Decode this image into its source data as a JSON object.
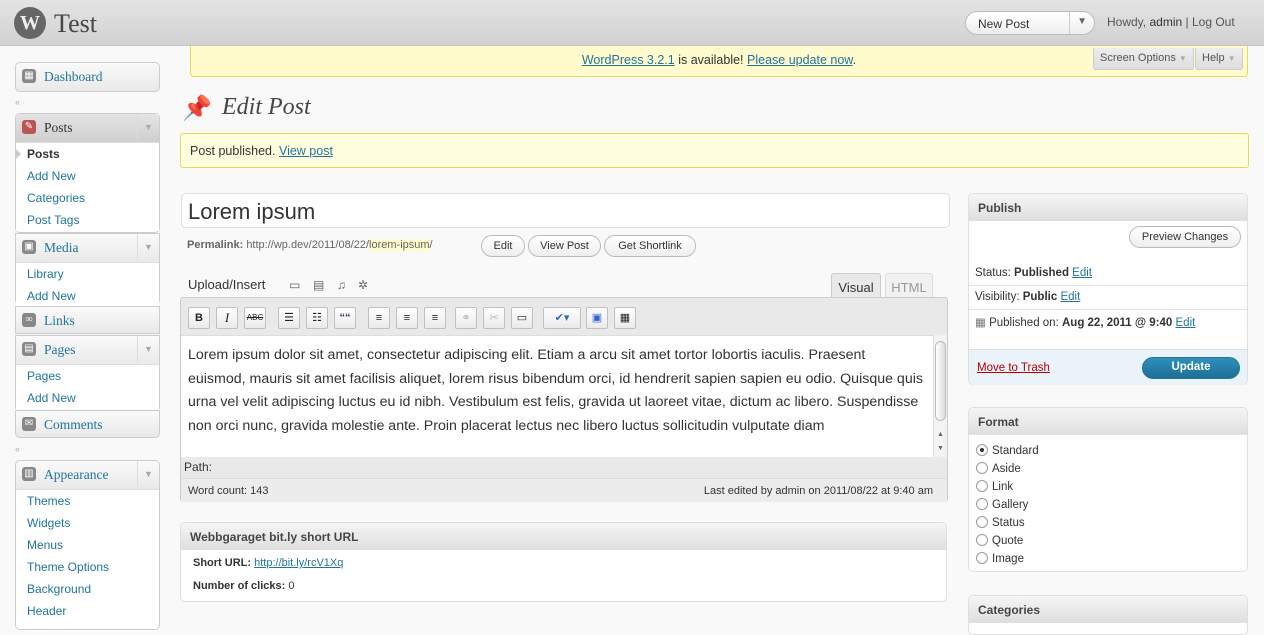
{
  "header": {
    "site_title": "Test",
    "new_post": "New Post",
    "howdy_prefix": "Howdy,",
    "user": "admin",
    "separator": "|",
    "logout": "Log Out"
  },
  "sidebar": {
    "dashboard": "Dashboard",
    "posts": {
      "label": "Posts",
      "items": [
        "Posts",
        "Add New",
        "Categories",
        "Post Tags"
      ]
    },
    "media": {
      "label": "Media",
      "items": [
        "Library",
        "Add New"
      ]
    },
    "links": "Links",
    "pages": {
      "label": "Pages",
      "items": [
        "Pages",
        "Add New"
      ]
    },
    "comments": "Comments",
    "appearance": {
      "label": "Appearance",
      "items": [
        "Themes",
        "Widgets",
        "Menus",
        "Theme Options",
        "Background",
        "Header"
      ]
    }
  },
  "update_notice": {
    "version_link": "WordPress 3.2.1",
    "text": " is available! ",
    "update_link": "Please update now",
    "end": "."
  },
  "screen_options": "Screen Options",
  "help": "Help",
  "page_title": "Edit Post",
  "message": {
    "text": "Post published. ",
    "link": "View post"
  },
  "post": {
    "title": "Lorem ipsum",
    "permalink_label": "Permalink:",
    "permalink_base": "http://wp.dev/2011/08/22/",
    "permalink_slug": "lorem-ipsum",
    "permalink_end": "/",
    "edit_button": "Edit",
    "view_button": "View Post",
    "shortlink_button": "Get Shortlink"
  },
  "editor": {
    "upload_label": "Upload/Insert",
    "tab_visual": "Visual",
    "tab_html": "HTML",
    "content": "Lorem ipsum dolor sit amet, consectetur adipiscing elit. Etiam a arcu sit amet tortor lobortis iaculis. Praesent euismod, mauris sit amet facilisis aliquet, lorem risus bibendum orci, id hendrerit sapien sapien eu odio. Quisque quis urna vel velit adipiscing luctus eu id nibh. Vestibulum est felis, gravida ut laoreet vitae, dictum ac libero. Suspendisse non orci nunc, gravida molestie ante. Proin placerat lectus nec libero luctus sollicitudin vulputate diam",
    "path_label": "Path:",
    "word_count": "Word count: 143",
    "last_edited": "Last edited by admin on 2011/08/22 at 9:40 am",
    "toolbar": {
      "bold": "B",
      "italic": "I",
      "strikethrough": "ABC",
      "blockquote": "““"
    }
  },
  "bitly": {
    "title": "Webbgaraget bit.ly short URL",
    "short_url_label": "Short URL:",
    "short_url": "http://bit.ly/rcV1Xq",
    "clicks_label": "Number of clicks:",
    "clicks": "0"
  },
  "publish": {
    "title": "Publish",
    "preview_button": "Preview Changes",
    "status_label": "Status:",
    "status_value": "Published",
    "visibility_label": "Visibility:",
    "visibility_value": "Public",
    "published_label": "Published on:",
    "published_value": "Aug 22, 2011 @ 9:40",
    "edit": "Edit",
    "trash": "Move to Trash",
    "update": "Update"
  },
  "format": {
    "title": "Format",
    "options": [
      "Standard",
      "Aside",
      "Link",
      "Gallery",
      "Status",
      "Quote",
      "Image"
    ],
    "selected": "Standard"
  },
  "categories": {
    "title": "Categories"
  }
}
